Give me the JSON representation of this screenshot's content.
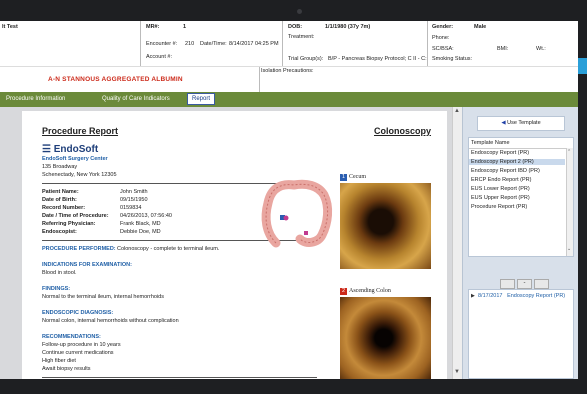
{
  "header": {
    "patient_name": "lt Test",
    "mr_label": "MR#:",
    "mr_value": "1",
    "encounter_label": "Encounter #:",
    "encounter_value": "210",
    "datetime_label": "Date/Time:",
    "datetime_value": "8/14/2017 04:25 PM",
    "account_label": "Account #:",
    "dob_label": "DOB:",
    "dob_value": "1/1/1980 (37y 7m)",
    "treatment_label": "Treatment:",
    "trial_label": "Trial Group(s):",
    "trial_value": "B/P - Pancreas Biopsy Protocol; C II - C:",
    "gender_label": "Gender:",
    "gender_value": "Male",
    "phone_label": "Phone:",
    "scbsa_label": "SC/BSA:",
    "bmi_label": "BMI:",
    "wt_label": "Wt.:",
    "smoking_label": "Smoking Status:",
    "isolation_label": "Isolation Precautions:"
  },
  "allergy": "A-N STANNOUS AGGREGATED ALBUMIN",
  "tabs": [
    {
      "label": "Procedure Information"
    },
    {
      "label": "Quality of Care Indicators"
    },
    {
      "label": "Report"
    }
  ],
  "report": {
    "title": "Procedure Report",
    "procedure_type": "Colonoscopy",
    "logo": "EndoSoft",
    "center_name": "EndoSoft Surgery Center",
    "address1": "135 Broadway",
    "address2": "Schenectady, New York 12305",
    "patient": [
      {
        "label": "Patient Name:",
        "value": "John Smith"
      },
      {
        "label": "Date of Birth:",
        "value": "09/15/1950"
      },
      {
        "label": "Record Number:",
        "value": "0159834"
      },
      {
        "label": "Date / Time of Procedure:",
        "value": "04/26/2013, 07:56:40"
      },
      {
        "label": "Referring Physician:",
        "value": "Frank Black, MD"
      },
      {
        "label": "Endoscopist:",
        "value": "Debbie Doe, MD"
      }
    ],
    "procedure_performed_label": "PROCEDURE PERFORMED:",
    "procedure_performed": "Colonoscopy - complete to terminal ileum.",
    "indications_label": "INDICATIONS FOR EXAMINATION:",
    "indications": "Blood in stool.",
    "findings_label": "FINDINGS:",
    "findings": "Normal to the terminal ileum, internal hemorrhoids",
    "diagnosis_label": "ENDOSCOPIC DIAGNOSIS:",
    "diagnosis": "Normal colon, internal hemorrhoids without complication",
    "recommendations_label": "RECOMMENDATIONS:",
    "recommendations": [
      "Follow-up procedure in 10 years",
      "Continue current medications",
      "High fiber diet",
      "Await biopsy results"
    ],
    "images": [
      {
        "num": "1",
        "caption": "Cecum"
      },
      {
        "num": "2",
        "caption": "Ascending Colon"
      }
    ]
  },
  "right_panel": {
    "use_template": "Use Template",
    "list_header": "Template Name",
    "templates": [
      "Endoscopy Report (PR)",
      "Endoscopy Report 2 (PR)",
      "Endoscopy Report IBD (PR)",
      "ERCP Endo Report (PR)",
      "EUS Lower Report (PR)",
      "EUS Upper Report (PR)",
      "Procedure Report (PR)"
    ],
    "selected_index": 1,
    "history_date": "8/17/2017",
    "history_name": "Endoscopy Report (PR)",
    "minus": "-"
  },
  "colors": {
    "tab_bar": "#6b8a3a",
    "allergy": "#cc2a1a",
    "section": "#1f5fa6",
    "history_link": "#1f5fa6"
  }
}
